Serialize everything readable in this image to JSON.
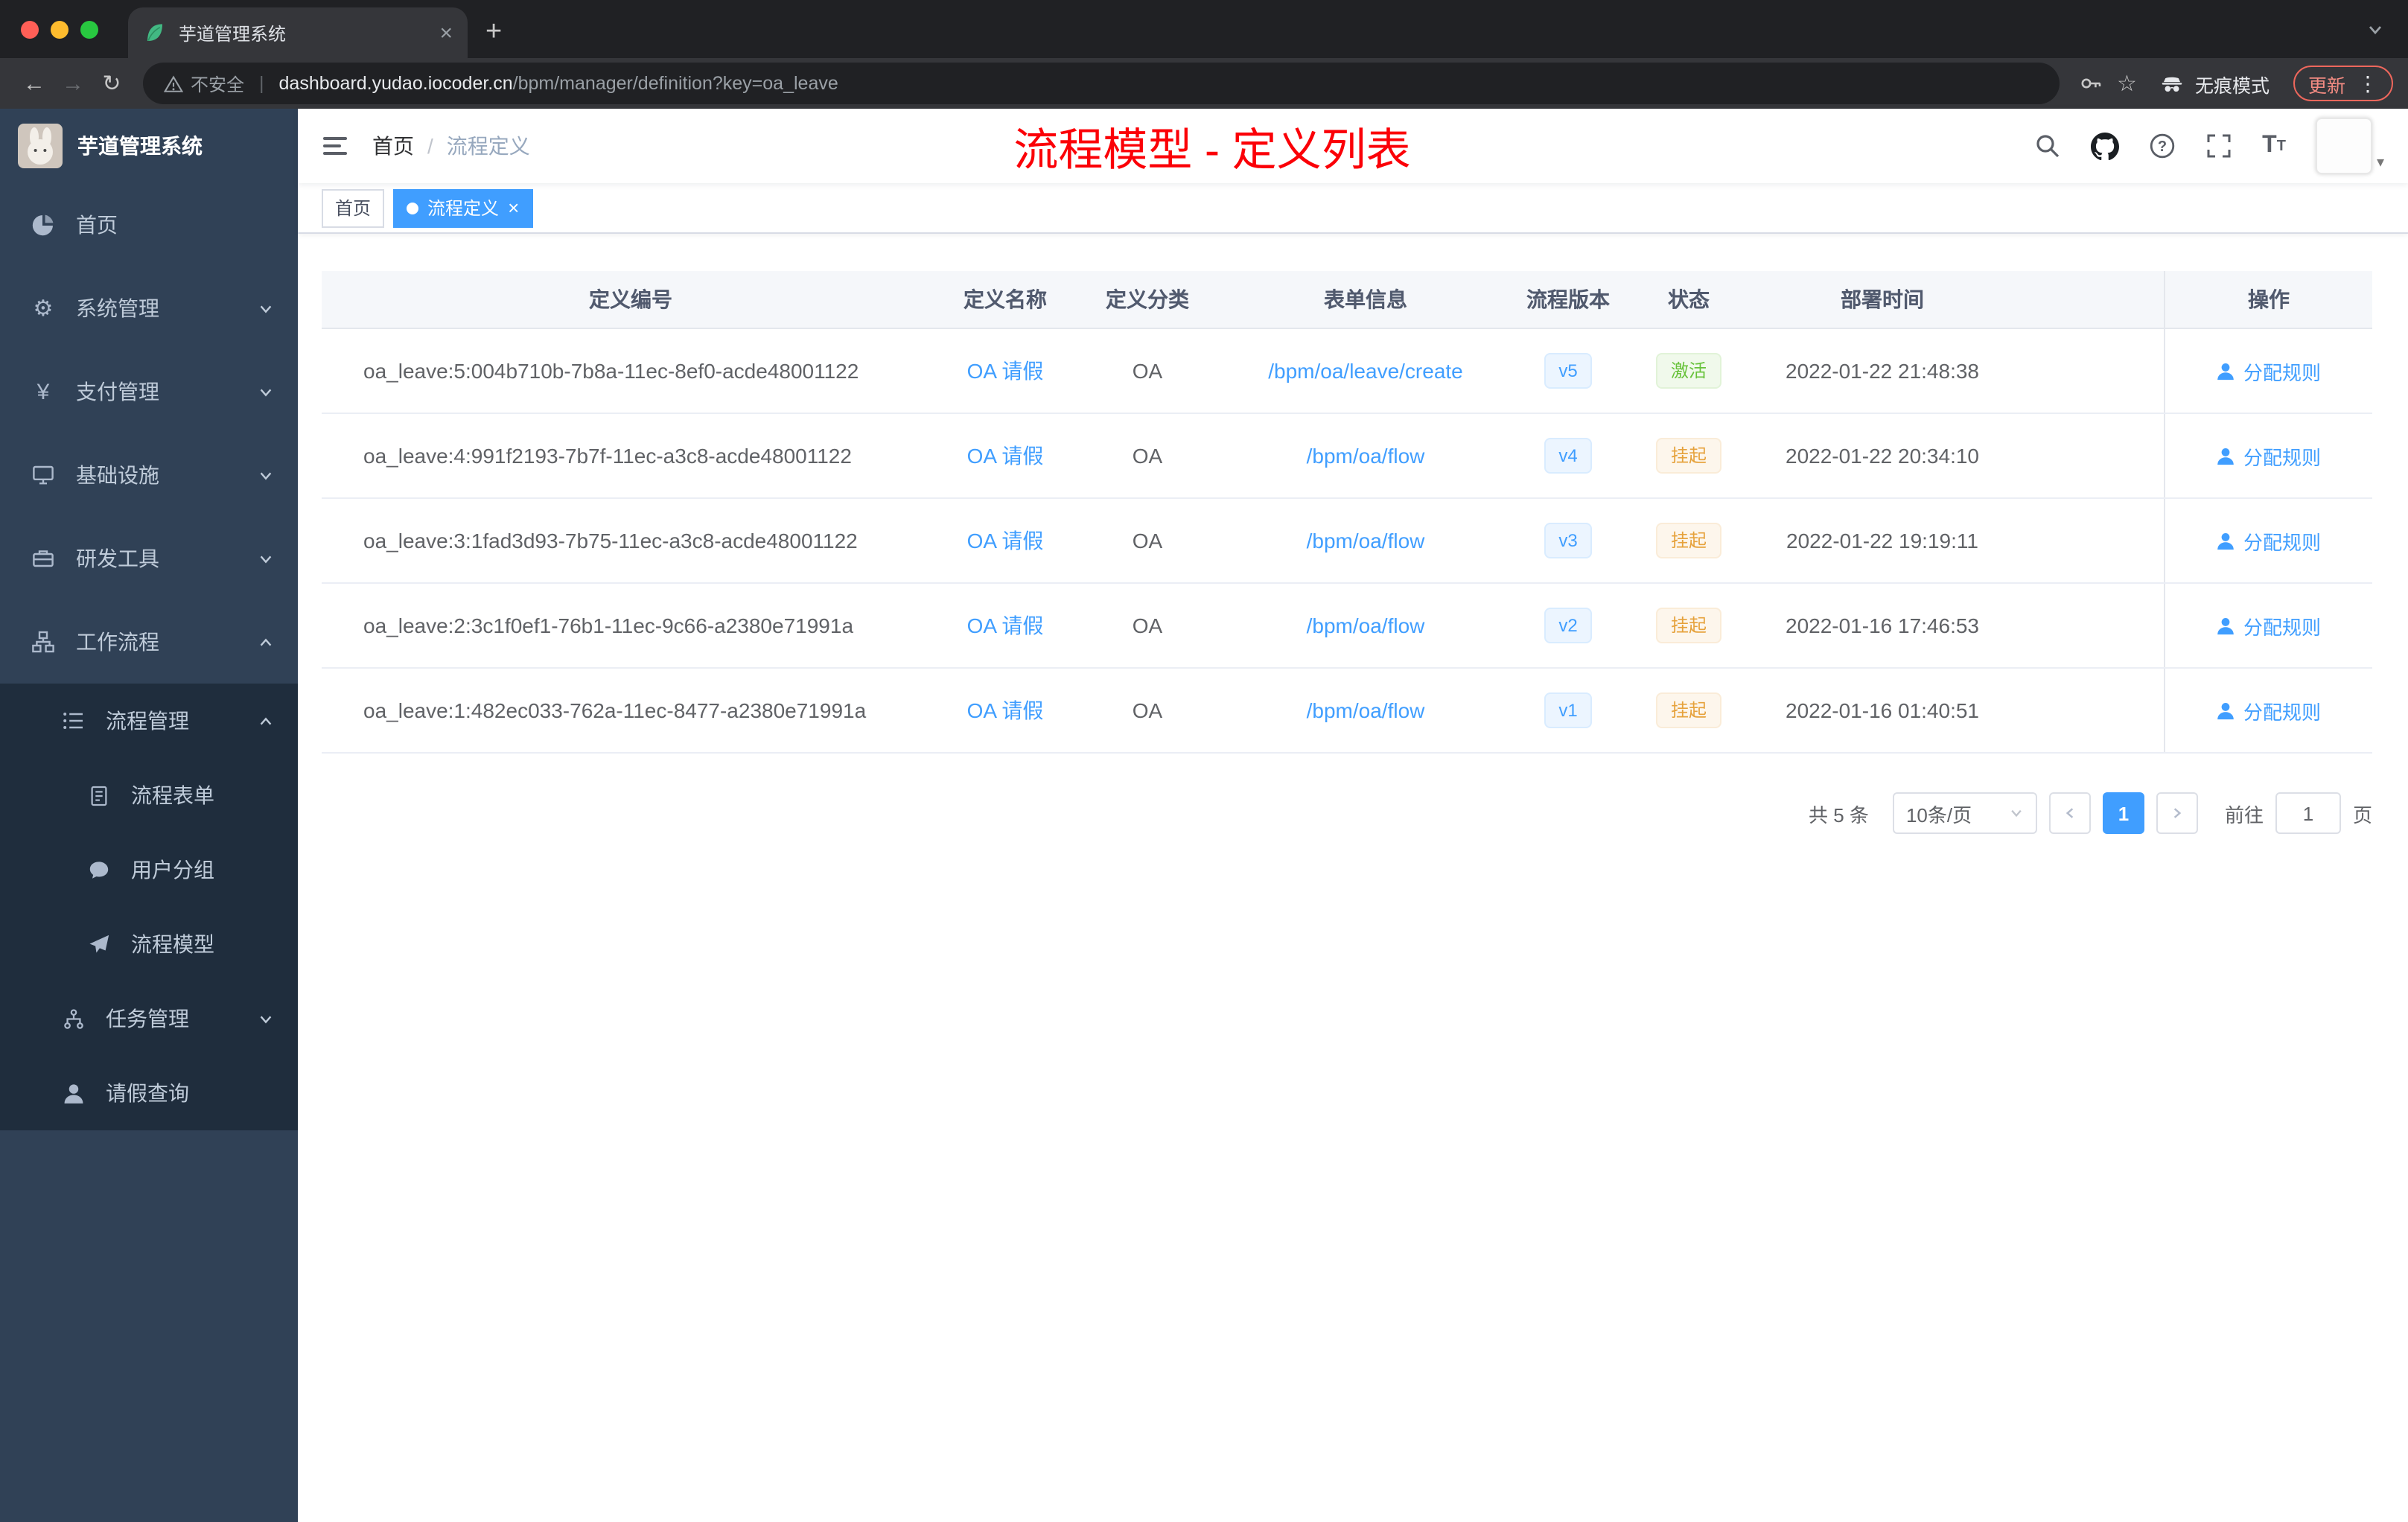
{
  "colors": {
    "accent": "#409eff",
    "success": "#67c23a",
    "warning": "#e6a23c",
    "annotation_red": "#fb0007",
    "sidebar_bg": "#304156",
    "submenu_bg": "#1f2d3d"
  },
  "browser": {
    "tab_title": "芋道管理系统",
    "security_label": "不安全",
    "url_domain": "dashboard.yudao.iocoder.cn",
    "url_path": "/bpm/manager/definition?key=oa_leave",
    "incognito_label": "无痕模式",
    "update_label": "更新"
  },
  "sidebar": {
    "logo_title": "芋道管理系统",
    "items": [
      {
        "label": "首页",
        "icon": "dashboard-icon"
      },
      {
        "label": "系统管理",
        "icon": "gear-icon"
      },
      {
        "label": "支付管理",
        "icon": "yen-icon"
      },
      {
        "label": "基础设施",
        "icon": "monitor-icon"
      },
      {
        "label": "研发工具",
        "icon": "toolbox-icon"
      },
      {
        "label": "工作流程",
        "icon": "workflow-icon"
      },
      {
        "label": "流程管理",
        "icon": "ordered-list-icon"
      },
      {
        "label": "流程表单",
        "icon": "document-icon"
      },
      {
        "label": "用户分组",
        "icon": "chat-group-icon"
      },
      {
        "label": "流程模型",
        "icon": "paper-plane-icon"
      },
      {
        "label": "任务管理",
        "icon": "org-tree-icon"
      },
      {
        "label": "请假查询",
        "icon": "person-icon"
      }
    ]
  },
  "header": {
    "breadcrumb_home": "首页",
    "breadcrumb_current": "流程定义",
    "annotation": "流程模型 - 定义列表"
  },
  "tags": {
    "home": "首页",
    "active": "流程定义"
  },
  "table": {
    "columns": [
      "定义编号",
      "定义名称",
      "定义分类",
      "表单信息",
      "流程版本",
      "状态",
      "部署时间",
      "操作"
    ],
    "rows": [
      {
        "id": "oa_leave:5:004b710b-7b8a-11ec-8ef0-acde48001122",
        "name": "OA 请假",
        "category": "OA",
        "form": "/bpm/oa/leave/create",
        "version": "v5",
        "status": "激活",
        "status_type": "success",
        "time": "2022-01-22 21:48:38",
        "action": "分配规则"
      },
      {
        "id": "oa_leave:4:991f2193-7b7f-11ec-a3c8-acde48001122",
        "name": "OA 请假",
        "category": "OA",
        "form": "/bpm/oa/flow",
        "version": "v4",
        "status": "挂起",
        "status_type": "warning",
        "time": "2022-01-22 20:34:10",
        "action": "分配规则"
      },
      {
        "id": "oa_leave:3:1fad3d93-7b75-11ec-a3c8-acde48001122",
        "name": "OA 请假",
        "category": "OA",
        "form": "/bpm/oa/flow",
        "version": "v3",
        "status": "挂起",
        "status_type": "warning",
        "time": "2022-01-22 19:19:11",
        "action": "分配规则"
      },
      {
        "id": "oa_leave:2:3c1f0ef1-76b1-11ec-9c66-a2380e71991a",
        "name": "OA 请假",
        "category": "OA",
        "form": "/bpm/oa/flow",
        "version": "v2",
        "status": "挂起",
        "status_type": "warning",
        "time": "2022-01-16 17:46:53",
        "action": "分配规则"
      },
      {
        "id": "oa_leave:1:482ec033-762a-11ec-8477-a2380e71991a",
        "name": "OA 请假",
        "category": "OA",
        "form": "/bpm/oa/flow",
        "version": "v1",
        "status": "挂起",
        "status_type": "warning",
        "time": "2022-01-16 01:40:51",
        "action": "分配规则"
      }
    ]
  },
  "pagination": {
    "total": "共 5 条",
    "page_size": "10条/页",
    "current_page": "1",
    "goto_label": "前往",
    "goto_value": "1",
    "page_unit": "页"
  }
}
